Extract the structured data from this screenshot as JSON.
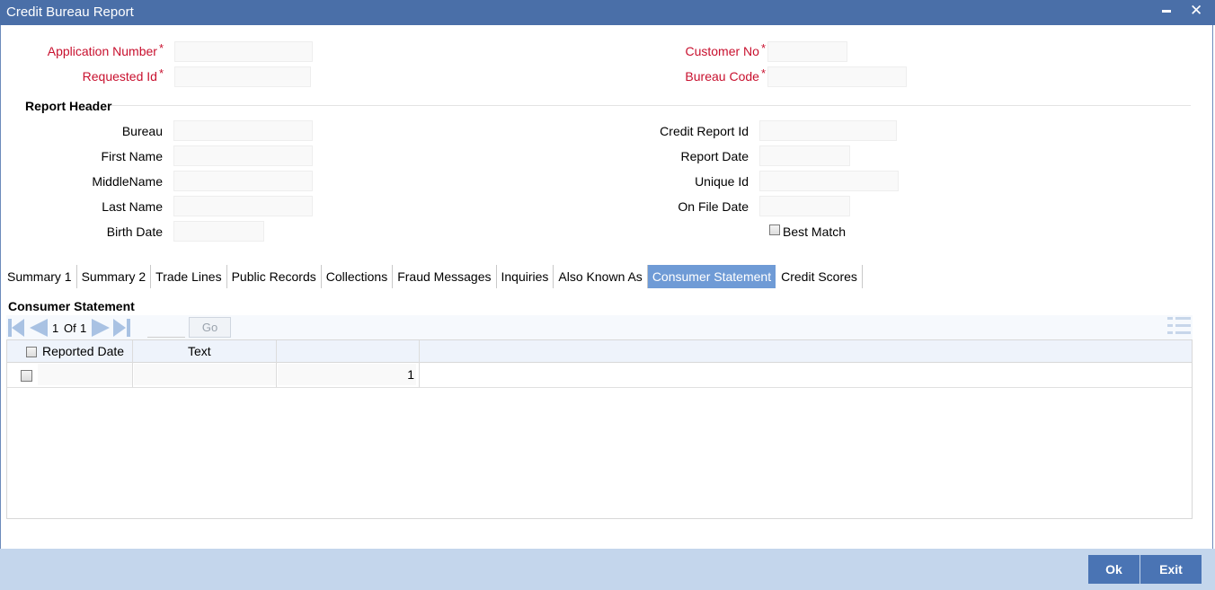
{
  "window": {
    "title": "Credit Bureau Report",
    "minimize_glyph": "▬",
    "close_glyph": "✕"
  },
  "form": {
    "application_number_label": "Application Number",
    "requested_id_label": "Requested Id",
    "customer_no_label": "Customer No",
    "bureau_code_label": "Bureau Code",
    "required_marker": "*"
  },
  "report_header": {
    "title": "Report Header",
    "bureau_label": "Bureau",
    "first_name_label": "First Name",
    "middle_name_label": "MiddleName",
    "last_name_label": "Last Name",
    "birth_date_label": "Birth Date",
    "credit_report_id_label": "Credit Report Id",
    "report_date_label": "Report Date",
    "unique_id_label": "Unique Id",
    "on_file_date_label": "On File Date",
    "best_match_label": "Best Match"
  },
  "tabs": [
    "Summary 1",
    "Summary 2",
    "Trade Lines",
    "Public Records",
    "Collections",
    "Fraud Messages",
    "Inquiries",
    "Also Known As",
    "Consumer Statement",
    "Credit Scores"
  ],
  "active_tab": "Consumer Statement",
  "consumer_statement": {
    "title": "Consumer Statement",
    "pager": {
      "current": "1",
      "of_label": "Of",
      "total": "1",
      "go_label": "Go"
    },
    "columns": [
      "Reported Date",
      "Text",
      ""
    ],
    "rows": [
      {
        "reported_date": "",
        "text": "",
        "seq": "1"
      }
    ]
  },
  "footer": {
    "ok_label": "Ok",
    "exit_label": "Exit"
  },
  "colors": {
    "title_bar": "#4a6fa8",
    "active_tab": "#6f9bd6",
    "required": "#c8102e",
    "button": "#4a74b4",
    "footer": "#c4d6ec"
  },
  "icons": [
    "minimize-icon",
    "close-icon",
    "first-page-icon",
    "prev-page-icon",
    "next-page-icon",
    "last-page-icon",
    "columns-menu-icon"
  ]
}
